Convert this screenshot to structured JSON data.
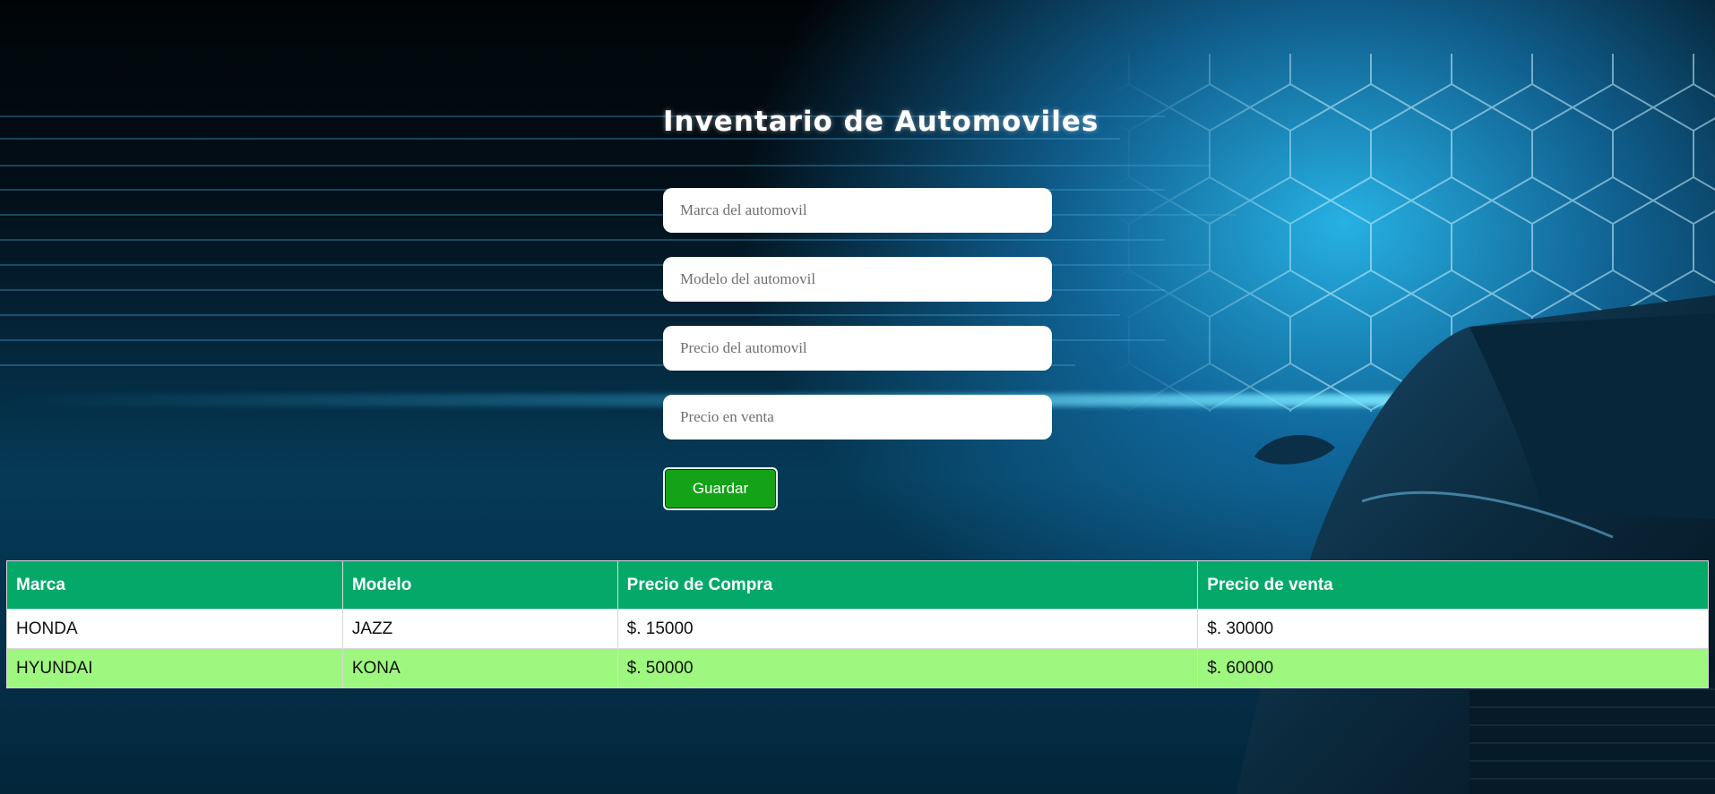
{
  "header": {
    "title": "Inventario de Automoviles"
  },
  "form": {
    "brand_placeholder": "Marca del automovil",
    "model_placeholder": "Modelo del automovil",
    "price_placeholder": "Precio del automovil",
    "sale_price_placeholder": "Precio en venta",
    "save_label": "Guardar"
  },
  "table": {
    "columns": [
      "Marca",
      "Modelo",
      "Precio de Compra",
      "Precio de venta"
    ],
    "rows": [
      [
        "HONDA",
        "JAZZ",
        "$. 15000",
        "$. 30000"
      ],
      [
        "HYUNDAI",
        "KONA",
        "$. 50000",
        "$. 60000"
      ]
    ]
  },
  "colors": {
    "table_header": "#04a96a",
    "row_alt": "#9ef77e",
    "save_button": "#14a318"
  }
}
